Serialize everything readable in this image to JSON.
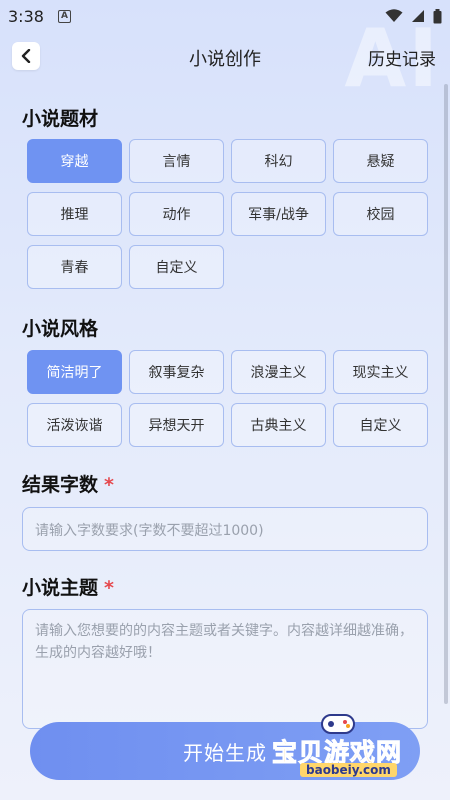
{
  "status": {
    "time": "3:38",
    "notif_letter": "A"
  },
  "watermark": "AI",
  "header": {
    "title": "小说创作",
    "history": "历史记录"
  },
  "genre": {
    "title": "小说题材",
    "options": [
      "穿越",
      "言情",
      "科幻",
      "悬疑",
      "推理",
      "动作",
      "军事/战争",
      "校园",
      "青春",
      "自定义"
    ],
    "selected": "穿越"
  },
  "style": {
    "title": "小说风格",
    "options": [
      "简洁明了",
      "叙事复杂",
      "浪漫主义",
      "现实主义",
      "活泼诙谐",
      "异想天开",
      "古典主义",
      "自定义"
    ],
    "selected": "简洁明了"
  },
  "word_count": {
    "title": "结果字数",
    "required_mark": "*",
    "placeholder": "请输入字数要求(字数不要超过1000)"
  },
  "theme": {
    "title": "小说主题",
    "required_mark": "*",
    "placeholder": "请输入您想要的的内容主题或者关键字。内容越详细越准确，生成的内容越好哦！"
  },
  "start_button": "开始生成",
  "logo": {
    "text": "宝贝游戏网",
    "url": "baobeiy.com"
  },
  "colors": {
    "accent": "#6f93f2",
    "required": "#e5484d"
  }
}
